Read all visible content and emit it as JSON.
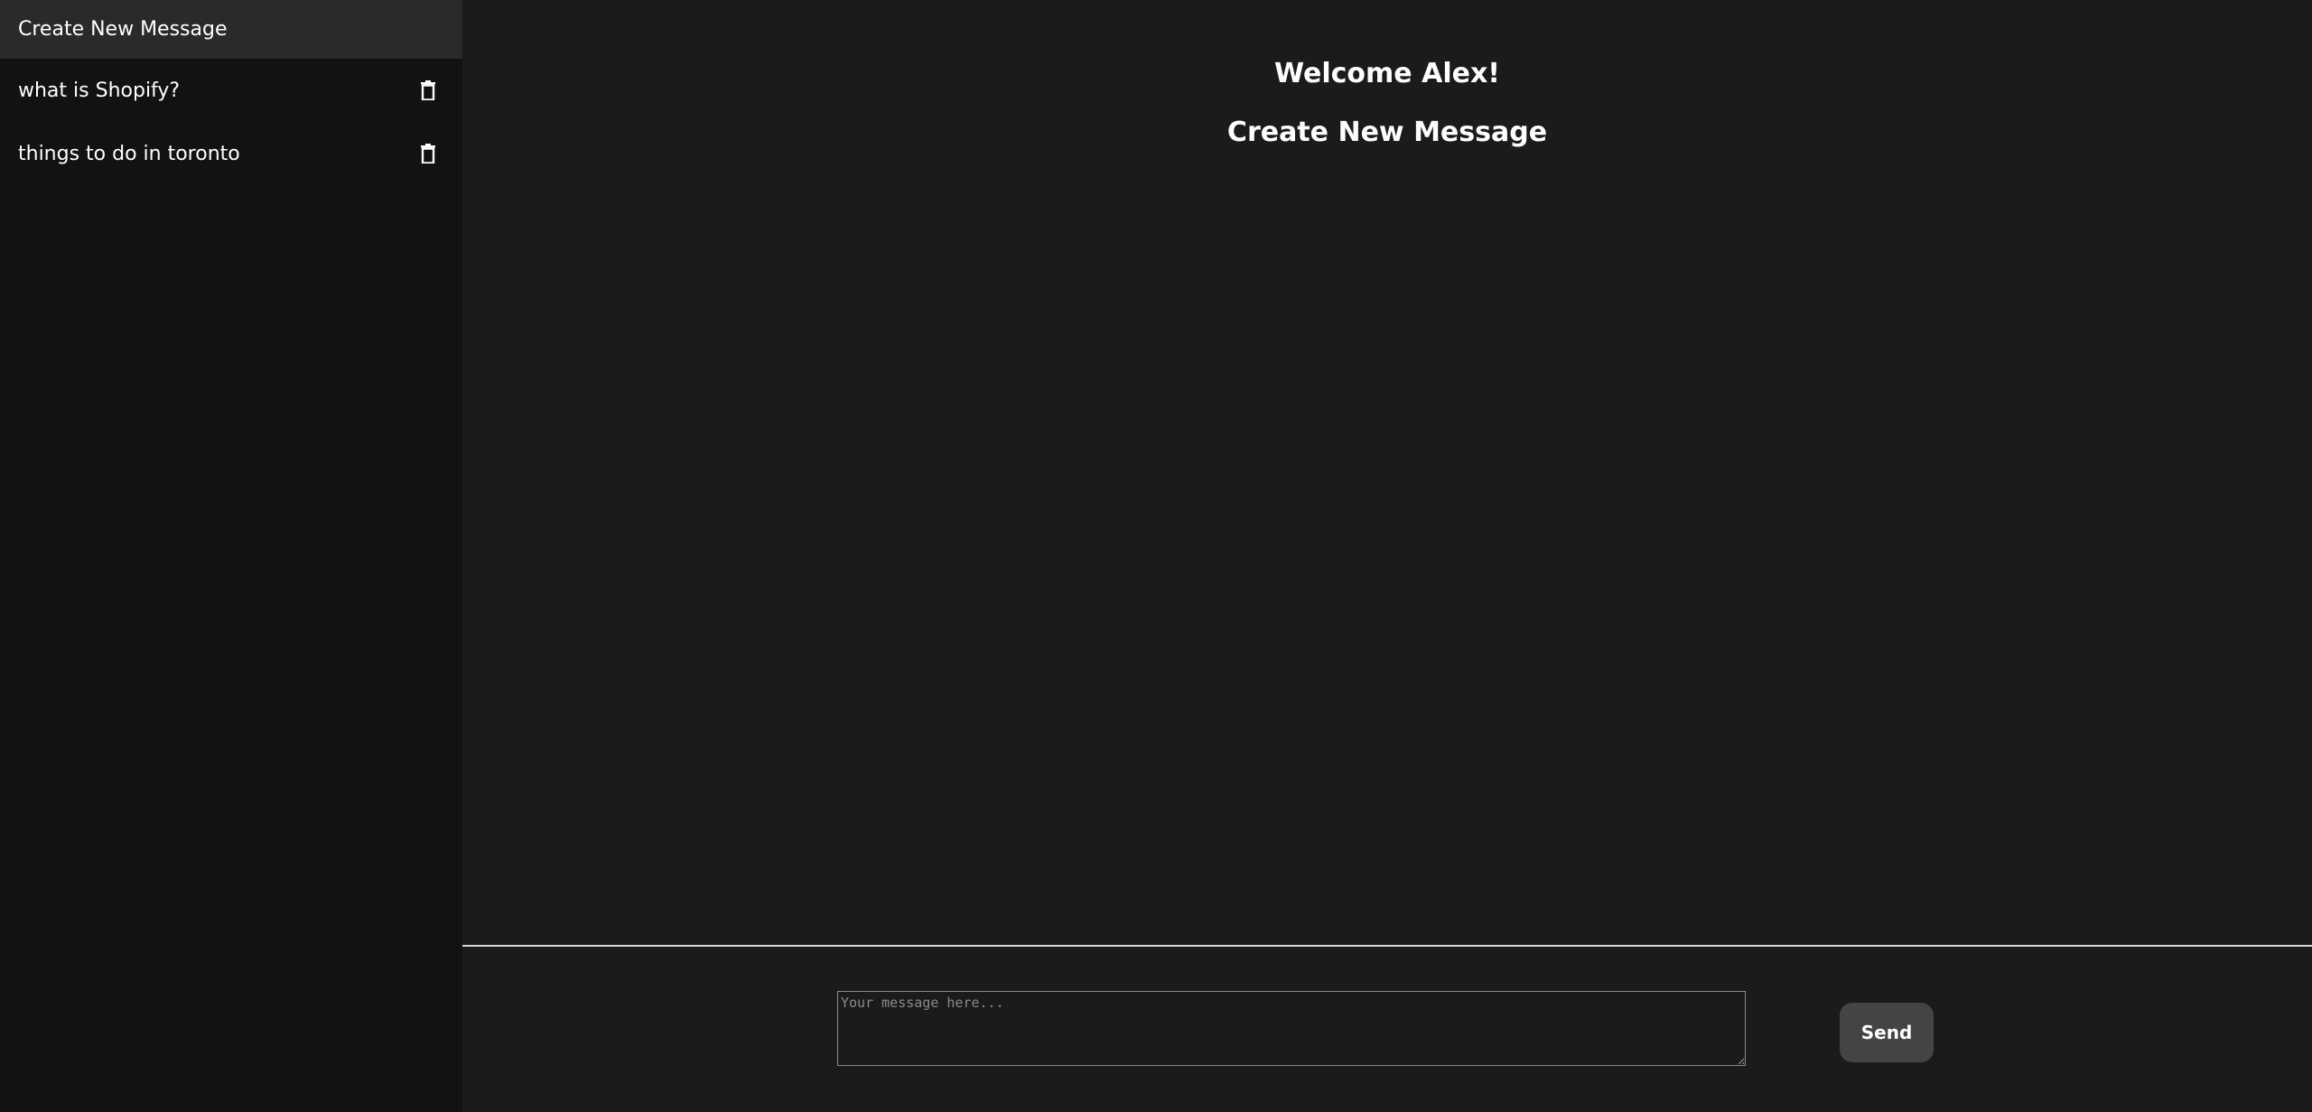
{
  "sidebar": {
    "new_message_label": "Create New Message",
    "items": [
      {
        "label": "what is Shopify?",
        "icon": "trash-icon"
      },
      {
        "label": "things to do in toronto",
        "icon": "trash-icon"
      }
    ]
  },
  "main": {
    "greeting": "Welcome Alex!",
    "subtitle": "Create New Message"
  },
  "composer": {
    "placeholder": "Your message here...",
    "value": "",
    "send_label": "Send"
  },
  "colors": {
    "background": "#1b1b1b",
    "sidebar": "#121212",
    "sidebar_active": "#2a2a2a",
    "send_button": "#444444",
    "divider": "#d8d8d8"
  }
}
